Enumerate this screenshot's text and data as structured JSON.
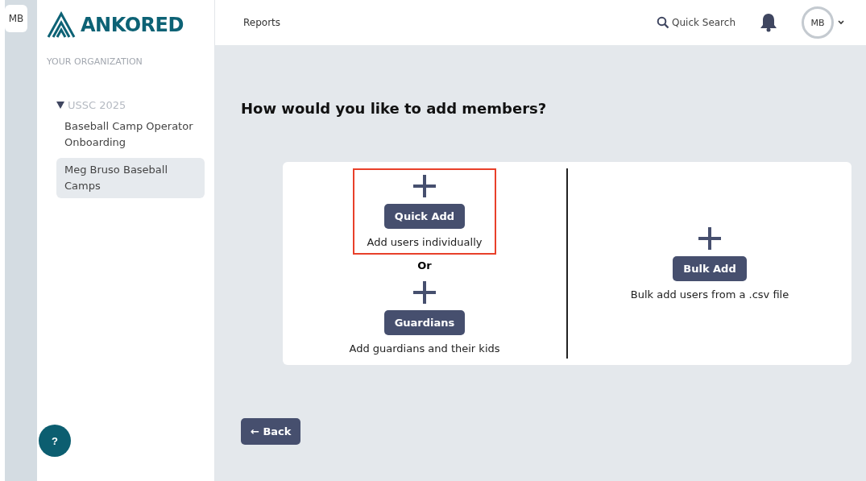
{
  "workspace_badge": "MB",
  "brand": {
    "name": "ANKORED"
  },
  "sidebar": {
    "section_label": "YOUR ORGANIZATION",
    "tree": [
      {
        "label": "USSC 2025",
        "expanded": true,
        "selected": false,
        "children": [
          {
            "label": "Baseball Camp Operator Onboarding",
            "selected": false
          },
          {
            "label": "Meg Bruso Baseball Camps",
            "selected": true
          }
        ]
      }
    ]
  },
  "help_button": "?",
  "header": {
    "nav": [
      "Reports"
    ],
    "search": "Quick Search",
    "avatar": "MB"
  },
  "page_title": "How would you like to add members?",
  "options_left": [
    {
      "button": "Quick Add",
      "description": "Add users individually",
      "highlighted": true
    },
    {
      "button": "Guardians",
      "description": "Add guardians and their kids",
      "highlighted": false
    }
  ],
  "separator": "Or",
  "options_right": [
    {
      "button": "Bulk Add",
      "description": "Bulk add users from a .csv file",
      "highlighted": false
    }
  ],
  "back_button": "← Back"
}
